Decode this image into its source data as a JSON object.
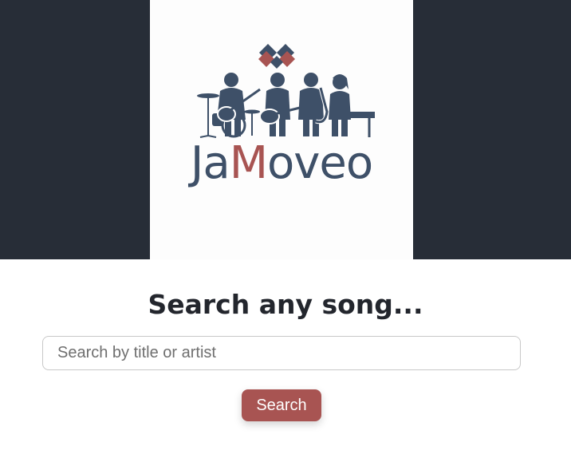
{
  "brand": {
    "name_part1": "Ja",
    "name_part2": "M",
    "name_part3": "oveo",
    "primary_color": "#3e5068",
    "accent_color": "#a85452"
  },
  "header": {
    "background_color": "#272d37"
  },
  "search": {
    "title": "Search any song...",
    "input_placeholder": "Search by title or artist",
    "input_value": "",
    "button_label": "Search",
    "button_color": "#a85452"
  }
}
